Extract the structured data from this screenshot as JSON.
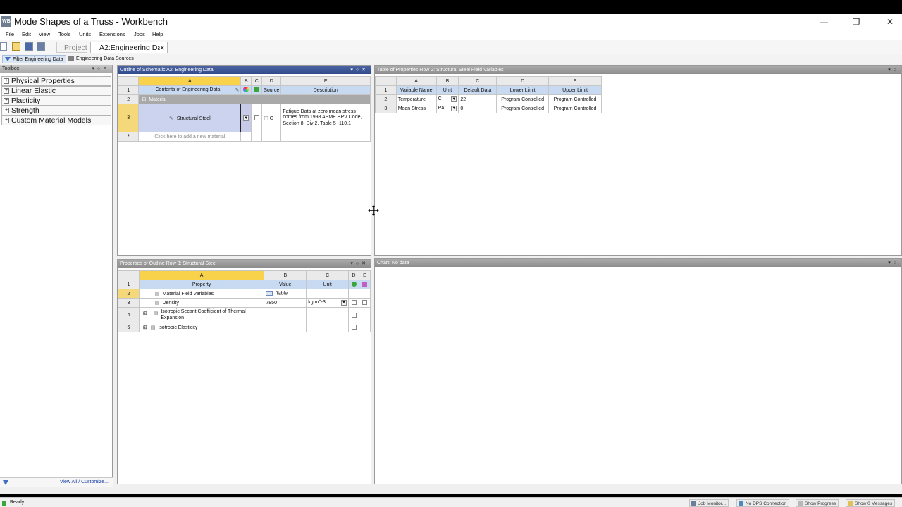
{
  "window": {
    "app_icon": "WB",
    "title": "Mode Shapes of a Truss - Workbench",
    "controls": [
      "minimize-icon",
      "restore-icon",
      "close-icon"
    ]
  },
  "menu": [
    "File",
    "Edit",
    "View",
    "Tools",
    "Units",
    "Extensions",
    "Jobs",
    "Help"
  ],
  "tabs": [
    {
      "label": "Project",
      "active": false
    },
    {
      "label": "A2:Engineering Data",
      "active": true
    }
  ],
  "toolbar2": {
    "filter": "Filter Engineering Data",
    "sources": "Engineering Data Sources"
  },
  "toolbox": {
    "title": "Toolbox",
    "items": [
      "Physical Properties",
      "Linear Elastic",
      "Plasticity",
      "Strength",
      "Custom Material Models"
    ],
    "footer_link": "View All / Customize..."
  },
  "outline": {
    "title": "Outline of Schematic A2: Engineering Data",
    "col_letters": [
      "A",
      "B",
      "C",
      "D",
      "E"
    ],
    "headers": {
      "a": "Contents of Engineering Data",
      "d": "Source",
      "e": "Description"
    },
    "group": "Material",
    "material": {
      "name": "Structural Steel",
      "source_prefix": "G",
      "description": "Fatigue Data at zero mean stress comes from 1998 ASME BPV Code, Section 8, Div 2, Table 5 -110.1"
    },
    "add_row": "Click here to add a new material",
    "row_nums": [
      "1",
      "2",
      "3",
      "*"
    ]
  },
  "field_vars": {
    "title": "Table of Properties Row 2: Structural Steel Field Variables",
    "col_letters": [
      "A",
      "B",
      "C",
      "D",
      "E"
    ],
    "headers": [
      "Variable Name",
      "Unit",
      "Default Data",
      "Lower Limit",
      "Upper Limit"
    ],
    "rows": [
      {
        "num": "2",
        "name": "Temperature",
        "unit": "C",
        "default": "22",
        "lower": "Program Controlled",
        "upper": "Program Controlled"
      },
      {
        "num": "3",
        "name": "Mean Stress",
        "unit": "Pa",
        "default": "0",
        "lower": "Program Controlled",
        "upper": "Program Controlled"
      }
    ]
  },
  "properties": {
    "title": "Properties of Outline Row 3: Structural Steel",
    "col_letters": [
      "A",
      "B",
      "C",
      "D",
      "E"
    ],
    "headers": {
      "a": "Property",
      "b": "Value",
      "c": "Unit"
    },
    "rows": [
      {
        "num": "2",
        "name": "Material Field Variables",
        "value": "Table",
        "unit": ""
      },
      {
        "num": "3",
        "name": "Density",
        "value": "7850",
        "unit": "kg m^-3"
      },
      {
        "num": "4",
        "name": "Isotropic Secant Coefficient of Thermal Expansion",
        "value": "",
        "unit": ""
      },
      {
        "num": "6",
        "name": "Isotropic Elasticity",
        "value": "",
        "unit": ""
      }
    ],
    "header_row_num": "1"
  },
  "chart": {
    "title": "Chart: No data"
  },
  "statusbar": {
    "status": "Ready",
    "buttons": [
      "Job Monitor...",
      "No DPS Connection",
      "Show Progress",
      "Show 0 Messages"
    ]
  },
  "colors": {
    "accent_title": "#2f4a8c",
    "selected_header": "#f9d24c",
    "column_header": "#c8daf2"
  }
}
